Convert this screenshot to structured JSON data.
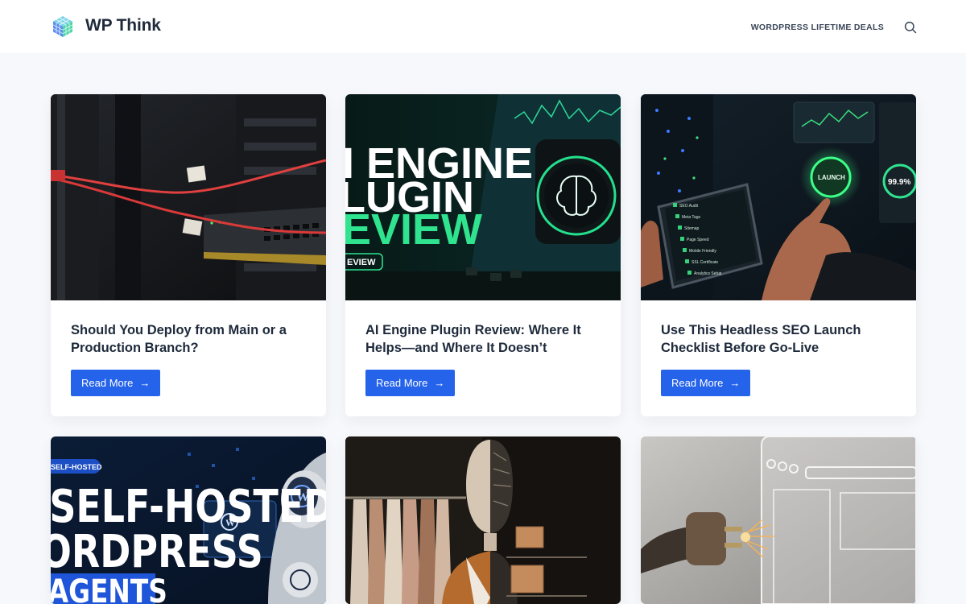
{
  "header": {
    "site_title": "WP Think",
    "nav_link": "WORDPRESS LIFETIME DEALS"
  },
  "colors": {
    "accent": "#2563eb",
    "title": "#1e2a3b",
    "background": "#f6f8fb"
  },
  "cards": [
    {
      "title": "Should You Deploy from Main or a Production Branch?",
      "read_more": "Read More",
      "image": {
        "subject": "server-rack-cables"
      }
    },
    {
      "title": "AI Engine Plugin Review: Where It Helps—and Where It Doesn’t",
      "read_more": "Read More",
      "image": {
        "subject": "ai-engine-banner",
        "line1": "I ENGINE",
        "line2": "LUGIN",
        "line3": "EVIEW",
        "tag": "EVIEW"
      }
    },
    {
      "title": "Use This Headless SEO Launch Checklist Before Go-Live",
      "read_more": "Read More",
      "image": {
        "subject": "launch-checklist",
        "button_text": "LAUNCH",
        "gauge_text": "99.9%",
        "checklist": [
          "SEO Audit",
          "Meta Tags",
          "Sitemap",
          "Page Speed",
          "Mobile Friendly",
          "SSL Certificate",
          "Analytics Setup"
        ]
      }
    },
    {
      "image": {
        "subject": "self-hosted-agents",
        "tag": "SELF-HOSTED",
        "line1": "SELF-HOSTED",
        "line2": "ORDPRESS",
        "line3": "AGENTS"
      }
    },
    {
      "image": {
        "subject": "mannequin-robot"
      }
    },
    {
      "image": {
        "subject": "plug-sparks"
      }
    }
  ]
}
